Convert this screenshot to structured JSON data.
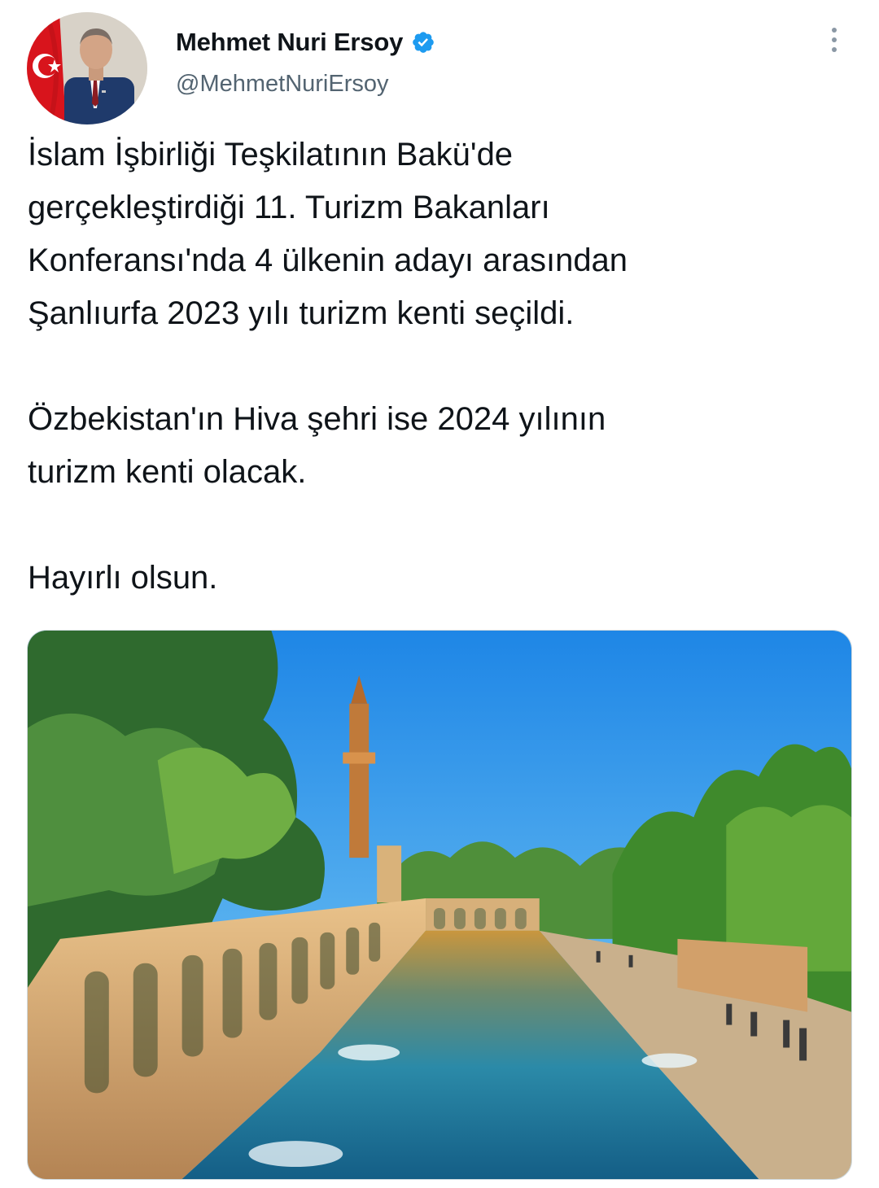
{
  "author": {
    "display_name": "Mehmet Nuri Ersoy",
    "handle": "@MehmetNuriErsoy",
    "verified": true,
    "avatar_icon": "profile-photo-with-turkish-flag",
    "verified_icon": "verified-badge-icon",
    "badge_color": "#1d9bf0"
  },
  "menu": {
    "icon": "more-options-icon"
  },
  "tweet": {
    "paragraphs": [
      "İslam İşbirliği Teşkilatının Bakü'de\ngerçekleştirdiği 11. Turizm Bakanları\nKonferansı'nda 4 ülkenin adayı arasından\nŞanlıurfa 2023 yılı turizm kenti seçildi.",
      "Özbekistan'ın Hiva şehri ise 2024 yılının\nturizm kenti olacak.",
      "Hayırlı olsun."
    ]
  },
  "media": {
    "type": "photo",
    "icon": "photo-balikligol-pool"
  }
}
